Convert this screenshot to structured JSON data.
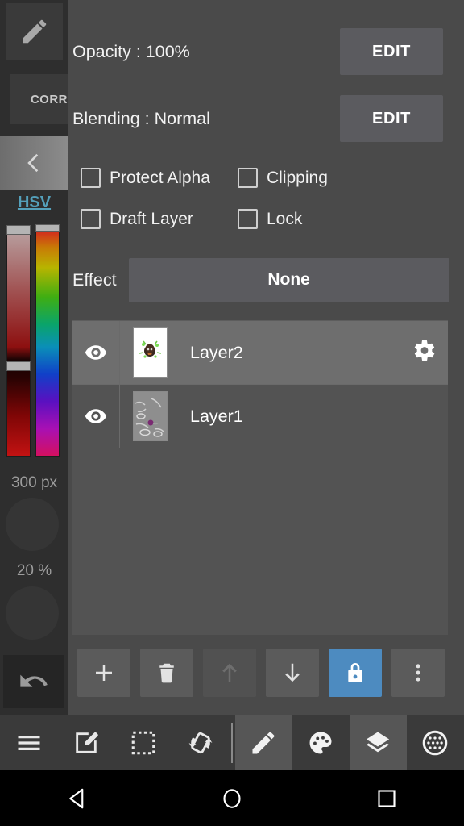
{
  "sidebar": {
    "tool_pencil_icon": "pencil-icon",
    "corr_label": "CORR",
    "collapse_icon": "chevron-left-icon",
    "color_mode_label": "HSV",
    "brush_size_label": "300 px",
    "brush_opacity_label": "20 %",
    "undo_icon": "undo-icon"
  },
  "panel": {
    "opacity": {
      "label": "Opacity : 100%",
      "edit_label": "EDIT"
    },
    "blending": {
      "label": "Blending : Normal",
      "edit_label": "EDIT"
    },
    "checkboxes": [
      {
        "label": "Protect Alpha",
        "checked": false
      },
      {
        "label": "Clipping",
        "checked": false
      },
      {
        "label": "Draft Layer",
        "checked": false
      },
      {
        "label": "Lock",
        "checked": false
      }
    ],
    "effect": {
      "label": "Effect",
      "value": "None"
    },
    "layers": [
      {
        "name": "Layer2",
        "visible": true,
        "selected": true,
        "has_gear": true
      },
      {
        "name": "Layer1",
        "visible": true,
        "selected": false,
        "has_gear": false
      }
    ],
    "actions": [
      {
        "name": "add-layer-button",
        "icon": "plus-icon",
        "state": "normal"
      },
      {
        "name": "delete-layer-button",
        "icon": "trash-icon",
        "state": "normal"
      },
      {
        "name": "move-layer-up-button",
        "icon": "arrow-up-icon",
        "state": "disabled"
      },
      {
        "name": "move-layer-down-button",
        "icon": "arrow-down-icon",
        "state": "normal"
      },
      {
        "name": "lock-layer-button",
        "icon": "lock-icon",
        "state": "active"
      },
      {
        "name": "more-options-button",
        "icon": "kebab-menu-icon",
        "state": "normal"
      }
    ]
  },
  "bottom_bar": [
    {
      "name": "menu-button",
      "icon": "hamburger-icon",
      "active": false
    },
    {
      "name": "edit-canvas-button",
      "icon": "compose-icon",
      "active": false
    },
    {
      "name": "selection-button",
      "icon": "marquee-icon",
      "active": false
    },
    {
      "name": "rotate-button",
      "icon": "rotate-icon",
      "active": false
    },
    {
      "name": "brush-button",
      "icon": "pencil-icon",
      "active": true
    },
    {
      "name": "palette-button",
      "icon": "palette-icon",
      "active": false
    },
    {
      "name": "layers-button",
      "icon": "layers-icon",
      "active": true
    },
    {
      "name": "texture-button",
      "icon": "dotted-circle-icon",
      "active": false
    }
  ],
  "android_nav": [
    {
      "name": "nav-back-button",
      "icon": "triangle-back-icon"
    },
    {
      "name": "nav-home-button",
      "icon": "circle-home-icon"
    },
    {
      "name": "nav-recents-button",
      "icon": "square-recents-icon"
    }
  ],
  "colors": {
    "panel_bg": "#4a4a4a",
    "accent_blue": "#4d8bc0",
    "hsv_link": "#54a0bb",
    "button_bg": "#5b5b5f"
  }
}
